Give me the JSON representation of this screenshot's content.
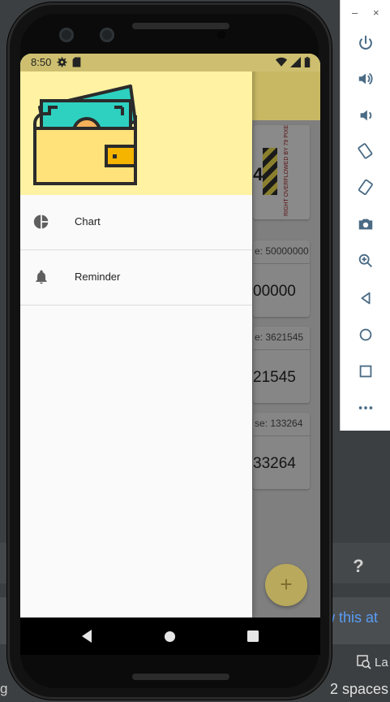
{
  "ide": {
    "help_label": "?",
    "link_text": "w this at",
    "footer_left": "g",
    "footer_right": "2 spaces",
    "la_text": "La"
  },
  "emulator_panel": {
    "minimize_label": "–",
    "close_label": "×",
    "buttons": [
      "power-icon",
      "volume-up-icon",
      "volume-down-icon",
      "rotate-left-icon",
      "rotate-right-icon",
      "camera-icon",
      "zoom-icon",
      "back-icon",
      "home-icon",
      "overview-icon",
      "more-icon"
    ]
  },
  "status_bar": {
    "time": "8:50"
  },
  "app": {
    "overflow_warning": "RIGHT OVERFLOWED BY 79 PIXELS",
    "overflow_number": "4",
    "cards": [
      {
        "subtitle": "e: 50000000",
        "value": "00000"
      },
      {
        "subtitle": "e: 3621545",
        "value": "21545"
      },
      {
        "subtitle": "se: 133264",
        "value": "33264"
      }
    ],
    "fab_label": "+"
  },
  "drawer": {
    "items": [
      {
        "label": "Chart",
        "icon": "pie-chart-icon"
      },
      {
        "label": "Reminder",
        "icon": "bell-icon"
      }
    ]
  },
  "colors": {
    "drawer_header": "#fff2a2",
    "wallet_bill": "#2ed1c0",
    "wallet_body": "#ffe27a",
    "wallet_clasp": "#f4b400"
  }
}
